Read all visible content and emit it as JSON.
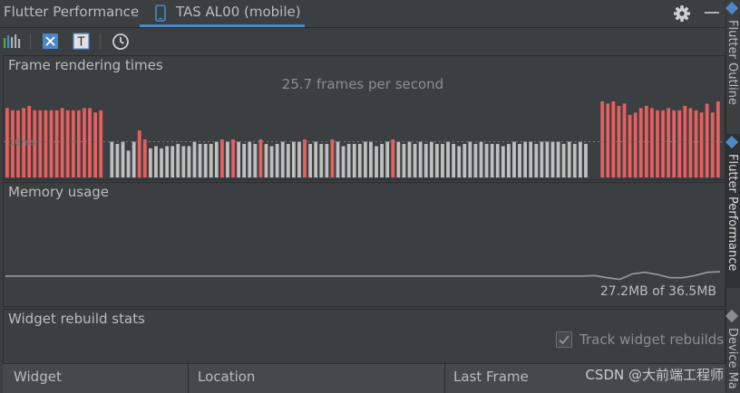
{
  "tabs": {
    "tool_window_title": "Flutter Performance",
    "device_tab_label": "TAS AL00 (mobile)"
  },
  "toolbar": {
    "icons": [
      "bar-chart-icon",
      "debug-paint-icon",
      "text-baseline-icon",
      "clock-icon"
    ],
    "baseline_glyph": "T"
  },
  "frame_panel": {
    "title": "Frame rendering times",
    "fps_text": "25.7 frames per second",
    "threshold_label": "16ms"
  },
  "memory_panel": {
    "title": "Memory usage",
    "summary": "27.2MB of 36.5MB"
  },
  "rebuild_panel": {
    "title": "Widget rebuild stats",
    "track_label": "Track widget rebuilds",
    "track_checked": true
  },
  "table": {
    "columns": [
      "Widget",
      "Location",
      "Last Frame"
    ]
  },
  "sidebar": {
    "tabs": [
      "Flutter Outline",
      "Flutter Performance",
      "Device Ma"
    ]
  },
  "watermark": "CSDN @大前端工程师",
  "colors": {
    "slow_frame": "#e85f5f",
    "normal_frame": "#bfbfbf",
    "memory_line": "#9a9a9a",
    "accent": "#4a88c7"
  },
  "chart_data": [
    {
      "type": "bar",
      "title": "Frame rendering times",
      "subtitle": "25.7 frames per second",
      "xlabel": "",
      "ylabel": "",
      "threshold_ms": 16,
      "ylim": [
        0,
        34
      ],
      "frames_ms": [
        31,
        30,
        30,
        31,
        32,
        30,
        30,
        30,
        30,
        30,
        31,
        30,
        30,
        30,
        31,
        31,
        29,
        30,
        0,
        16,
        15,
        16,
        12,
        16,
        21,
        17,
        13,
        14,
        13,
        14,
        14,
        15,
        14,
        14,
        16,
        15,
        15,
        15,
        16,
        17,
        16,
        17,
        16,
        15,
        16,
        15,
        17,
        15,
        14,
        15,
        16,
        15,
        16,
        16,
        17,
        15,
        16,
        15,
        15,
        17,
        16,
        14,
        15,
        15,
        15,
        16,
        16,
        14,
        15,
        16,
        17,
        16,
        15,
        16,
        15,
        16,
        15,
        16,
        15,
        15,
        16,
        15,
        14,
        15,
        16,
        15,
        16,
        15,
        15,
        15,
        14,
        15,
        16,
        15,
        16,
        16,
        15,
        16,
        16,
        16,
        16,
        15,
        16,
        15,
        16,
        15,
        0,
        0,
        34,
        33,
        34,
        32,
        33,
        28,
        29,
        31,
        32,
        31,
        30,
        30,
        31,
        30,
        30,
        32,
        31,
        30,
        29,
        33,
        29,
        34
      ]
    },
    {
      "type": "line",
      "title": "Memory usage",
      "xlabel": "",
      "ylabel": "",
      "ylim_mb": [
        0,
        36.5
      ],
      "y_mb": [
        9.0,
        9.0,
        9.0,
        9.0,
        9.0,
        9.0,
        9.0,
        9.0,
        9.0,
        9.0,
        9.0,
        9.0,
        9.0,
        9.0,
        9.0,
        9.0,
        9.0,
        9.0,
        9.0,
        9.0,
        9.0,
        9.0,
        9.0,
        9.0,
        9.0,
        9.0,
        9.0,
        9.0,
        9.0,
        9.0,
        9.0,
        9.0,
        9.0,
        9.0,
        9.0,
        9.0,
        9.0,
        9.0,
        9.0,
        9.0,
        9.0,
        9.0,
        9.0,
        9.0,
        9.0,
        9.0,
        9.0,
        9.2,
        8.4,
        7.8,
        9.8,
        10.4,
        9.6,
        8.4,
        8.4,
        9.2,
        10.4,
        10.6
      ]
    }
  ]
}
